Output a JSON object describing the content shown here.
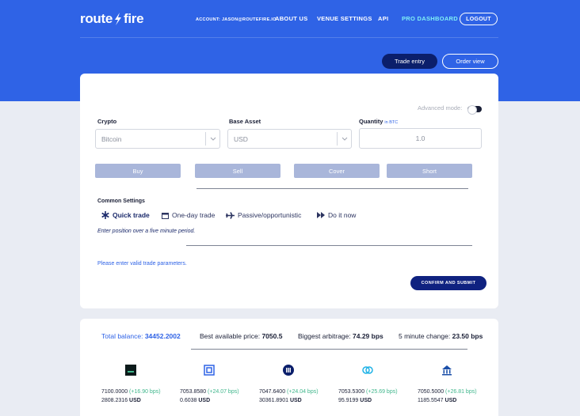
{
  "brand": {
    "name_left": "route",
    "name_right": "fire"
  },
  "nav": {
    "account": "ACCOUNT: JASON@ROUTEFIRE.IO",
    "about": "ABOUT US",
    "venue": "VENUE SETTINGS",
    "api": "API",
    "pro": "PRO DASHBOARD",
    "logout": "LOGOUT"
  },
  "views": {
    "trade_entry": "Trade entry",
    "order_view": "Order view"
  },
  "form": {
    "advanced_mode": "Advanced mode:",
    "advanced_mode_on": false,
    "crypto_label": "Crypto",
    "crypto_value": "Bitcoin",
    "base_label": "Base Asset",
    "base_value": "USD",
    "qty_label": "Quantity",
    "qty_unit": "in BTC",
    "qty_value": "1.0"
  },
  "actions": {
    "buy": "Buy",
    "sell": "Sell",
    "cover": "Cover",
    "short": "Short"
  },
  "common": {
    "title": "Common Settings",
    "modes": [
      {
        "label": "Quick trade",
        "icon": "asterisk-icon",
        "active": true
      },
      {
        "label": "One-day trade",
        "icon": "calendar-icon",
        "active": false
      },
      {
        "label": "Passive/opportunistic",
        "icon": "airplane-icon",
        "active": false
      },
      {
        "label": "Do it now",
        "icon": "fast-forward-icon",
        "active": false
      }
    ],
    "hint": "Enter position over a five minute period.",
    "error": "Please enter valid trade parameters.",
    "submit": "CONFIRM AND SUBMIT"
  },
  "stats": {
    "balance_label": "Total balance:",
    "balance_value": "34452.2002",
    "best_label": "Best available price:",
    "best_value": "7050.5",
    "arb_label": "Biggest arbitrage:",
    "arb_value": "74.29 bps",
    "change_label": "5 minute change:",
    "change_value": "23.50 bps"
  },
  "exchanges": [
    {
      "icon": "exchange-square-icon",
      "price": "7100.0000",
      "change": "(+16.90 bps)",
      "amount": "2808.2316",
      "unit": "USD",
      "color": "#0c1a1a"
    },
    {
      "icon": "exchange-stack-icon",
      "price": "7053.8580",
      "change": "(+24.07 bps)",
      "amount": "0.6038",
      "unit": "USD",
      "color": "#2f63e6"
    },
    {
      "icon": "exchange-bars-icon",
      "price": "7047.6400",
      "change": "(+24.04 bps)",
      "amount": "30361.8901",
      "unit": "USD",
      "color": "#0b1f6b"
    },
    {
      "icon": "exchange-link-icon",
      "price": "7053.5300",
      "change": "(+25.69 bps)",
      "amount": "95.9199",
      "unit": "USD",
      "color": "#1fb2e6"
    },
    {
      "icon": "exchange-bank-icon",
      "price": "7050.5000",
      "change": "(+26.81 bps)",
      "amount": "1185.5547",
      "unit": "USD",
      "color": "#1b4fa8"
    }
  ]
}
